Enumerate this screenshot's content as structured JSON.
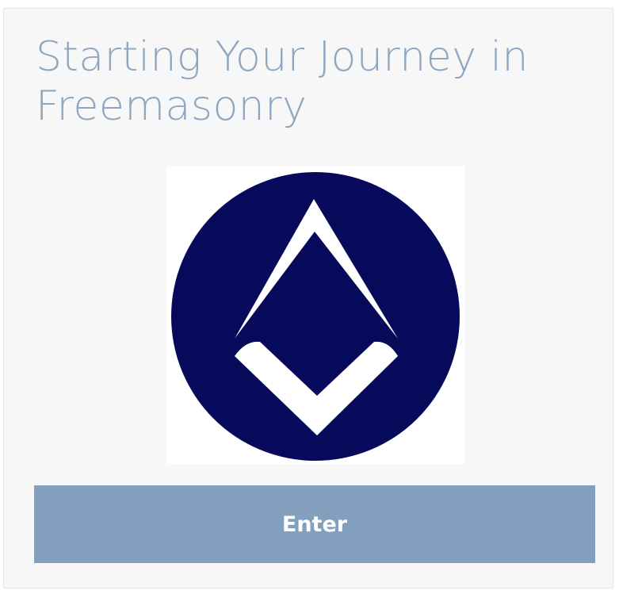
{
  "card": {
    "title": "Starting Your Journey in Freemasonry",
    "logo_icon": "square-and-compass-icon",
    "enter_label": "Enter"
  },
  "colors": {
    "title": "#8da7c2",
    "logo_circle": "#070a5a",
    "button": "#839fbe",
    "card_background": "#f7f7f7"
  }
}
